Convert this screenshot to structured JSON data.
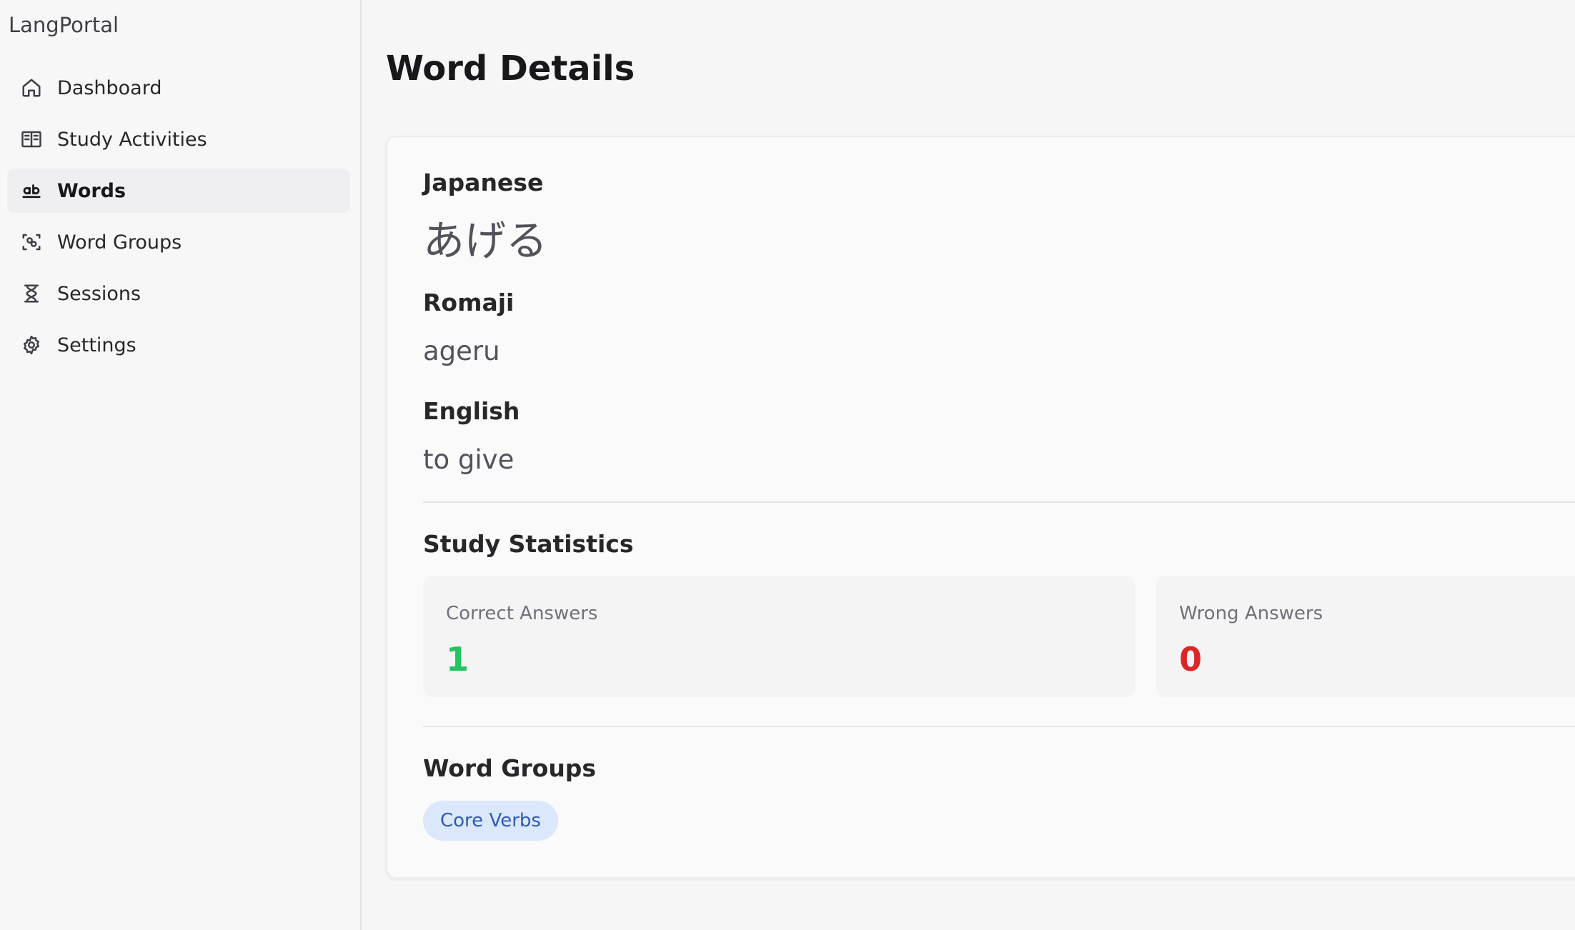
{
  "app": {
    "brand": "LangPortal"
  },
  "sidebar": {
    "items": [
      {
        "label": "Dashboard",
        "icon": "home-icon",
        "active": false
      },
      {
        "label": "Study Activities",
        "icon": "book-open-icon",
        "active": false
      },
      {
        "label": "Words",
        "icon": "ab-text-icon",
        "active": true
      },
      {
        "label": "Word Groups",
        "icon": "scan-group-icon",
        "active": false
      },
      {
        "label": "Sessions",
        "icon": "hourglass-icon",
        "active": false
      },
      {
        "label": "Settings",
        "icon": "gear-icon",
        "active": false
      }
    ]
  },
  "main": {
    "title": "Word Details",
    "japanese": {
      "label": "Japanese",
      "value": "あげる"
    },
    "romaji": {
      "label": "Romaji",
      "value": "ageru"
    },
    "english": {
      "label": "English",
      "value": "to give"
    },
    "stats": {
      "heading": "Study Statistics",
      "correct": {
        "label": "Correct Answers",
        "value": "1",
        "color": "#22c55e"
      },
      "wrong": {
        "label": "Wrong Answers",
        "value": "0",
        "color": "#dc2626"
      }
    },
    "groups": {
      "heading": "Word Groups",
      "tags": [
        "Core Verbs"
      ]
    }
  }
}
